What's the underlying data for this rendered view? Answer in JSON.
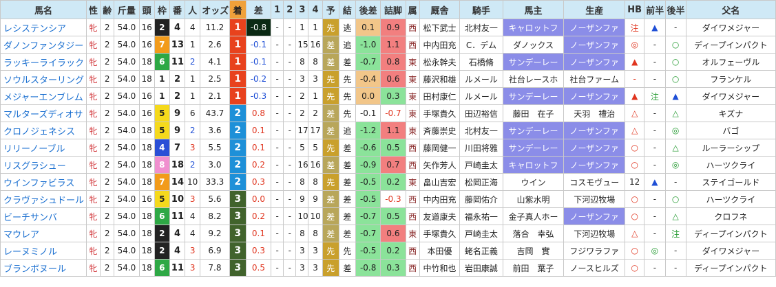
{
  "headers": {
    "name": "馬名",
    "sex": "性",
    "age": "齢",
    "weight": "斤量",
    "heads": "頭",
    "waku": "枠",
    "umaban": "番",
    "ninki": "人",
    "odds": "オッズ",
    "chaku": "着",
    "diff": "差",
    "c1": "1",
    "c2": "2",
    "c3": "3",
    "c4": "4",
    "yoso": "予",
    "kekka": "結",
    "kohansa": "後差",
    "tsumeashi": "詰脚",
    "zoku": "属",
    "kyusha": "厩舎",
    "kishu": "騎手",
    "banushi": "馬主",
    "seisan": "生産",
    "hb": "HB",
    "zenhan": "前半",
    "kohan": "後半",
    "father": "父名"
  },
  "rows": [
    {
      "name": "レシステンシア",
      "sex": "牝",
      "age": "2",
      "weight": "54.0",
      "heads": "16",
      "waku": "2",
      "umaban": "4",
      "ninki": "4",
      "odds": "11.2",
      "chaku": "1",
      "diff": "-0.8",
      "c1": "-",
      "c2": "-",
      "c3": "1",
      "c4": "1",
      "yoso": "先",
      "kekka": "逃",
      "kohansa": "0.1",
      "tsumeashi": "0.9",
      "zoku": "西",
      "kyusha": "松下武士",
      "kishu": "北村友一",
      "banushi": "キャロットフ",
      "seisan": "ノーザンファ",
      "hb": "注",
      "zenhan": "▲",
      "kohan": "-",
      "father": "ダイワメジャー"
    },
    {
      "name": "ダノンファンタジー",
      "sex": "牝",
      "age": "2",
      "weight": "54.0",
      "heads": "16",
      "waku": "7",
      "umaban": "13",
      "ninki": "1",
      "odds": "2.6",
      "chaku": "1",
      "diff": "-0.1",
      "c1": "-",
      "c2": "-",
      "c3": "15",
      "c4": "16",
      "yoso": "差",
      "kekka": "追",
      "kohansa": "-1.0",
      "tsumeashi": "1.1",
      "zoku": "西",
      "kyusha": "中内田充",
      "kishu": "C．デム",
      "banushi": "ダノックス",
      "seisan": "ノーザンファ",
      "hb": "◎",
      "zenhan": "-",
      "kohan": "○",
      "father": "ディープインパクト"
    },
    {
      "name": "ラッキーライラック",
      "sex": "牝",
      "age": "2",
      "weight": "54.0",
      "heads": "18",
      "waku": "6",
      "umaban": "11",
      "ninki": "2",
      "odds": "4.1",
      "chaku": "1",
      "diff": "-0.1",
      "c1": "-",
      "c2": "-",
      "c3": "8",
      "c4": "8",
      "yoso": "差",
      "kekka": "差",
      "kohansa": "-0.7",
      "tsumeashi": "0.8",
      "zoku": "東",
      "kyusha": "松永幹夫",
      "kishu": "石橋脩",
      "banushi": "サンデーレー",
      "seisan": "ノーザンファ",
      "hb": "▲",
      "zenhan": "-",
      "kohan": "○",
      "father": "オルフェーヴル"
    },
    {
      "name": "ソウルスターリング",
      "sex": "牝",
      "age": "2",
      "weight": "54.0",
      "heads": "18",
      "waku": "1",
      "umaban": "2",
      "ninki": "1",
      "odds": "2.5",
      "chaku": "1",
      "diff": "-0.2",
      "c1": "-",
      "c2": "-",
      "c3": "3",
      "c4": "3",
      "yoso": "先",
      "kekka": "先",
      "kohansa": "-0.4",
      "tsumeashi": "0.6",
      "zoku": "東",
      "kyusha": "藤沢和雄",
      "kishu": "ルメール",
      "banushi": "社台レースホ",
      "seisan": "社台ファーム",
      "hb": "-",
      "zenhan": "-",
      "kohan": "○",
      "father": "フランケル"
    },
    {
      "name": "メジャーエンブレム",
      "sex": "牝",
      "age": "2",
      "weight": "54.0",
      "heads": "16",
      "waku": "1",
      "umaban": "2",
      "ninki": "1",
      "odds": "2.1",
      "chaku": "1",
      "diff": "-0.3",
      "c1": "-",
      "c2": "-",
      "c3": "2",
      "c4": "1",
      "yoso": "先",
      "kekka": "先",
      "kohansa": "0.0",
      "tsumeashi": "0.3",
      "zoku": "東",
      "kyusha": "田村康仁",
      "kishu": "ルメール",
      "banushi": "サンデーレー",
      "seisan": "ノーザンファ",
      "hb": "▲",
      "zenhan": "注",
      "kohan": "▲",
      "father": "ダイワメジャー"
    },
    {
      "name": "マルターズディオサ",
      "sex": "牝",
      "age": "2",
      "weight": "54.0",
      "heads": "16",
      "waku": "5",
      "umaban": "9",
      "ninki": "6",
      "odds": "43.7",
      "chaku": "2",
      "diff": "0.8",
      "c1": "-",
      "c2": "-",
      "c3": "2",
      "c4": "2",
      "yoso": "差",
      "kekka": "先",
      "kohansa": "-0.1",
      "tsumeashi": "-0.7",
      "zoku": "東",
      "kyusha": "手塚貴久",
      "kishu": "田辺裕信",
      "banushi": "藤田　在子",
      "seisan": "天羽　禮治",
      "hb": "△",
      "zenhan": "-",
      "kohan": "△",
      "father": "キズナ"
    },
    {
      "name": "クロノジェネシス",
      "sex": "牝",
      "age": "2",
      "weight": "54.0",
      "heads": "18",
      "waku": "5",
      "umaban": "9",
      "ninki": "2",
      "odds": "3.6",
      "chaku": "2",
      "diff": "0.1",
      "c1": "-",
      "c2": "-",
      "c3": "17",
      "c4": "17",
      "yoso": "差",
      "kekka": "追",
      "kohansa": "-1.2",
      "tsumeashi": "1.1",
      "zoku": "東",
      "kyusha": "斉藤崇史",
      "kishu": "北村友一",
      "banushi": "サンデーレー",
      "seisan": "ノーザンファ",
      "hb": "△",
      "zenhan": "-",
      "kohan": "◎",
      "father": "バゴ"
    },
    {
      "name": "リリーノーブル",
      "sex": "牝",
      "age": "2",
      "weight": "54.0",
      "heads": "18",
      "waku": "4",
      "umaban": "7",
      "ninki": "3",
      "odds": "5.5",
      "chaku": "2",
      "diff": "0.1",
      "c1": "-",
      "c2": "-",
      "c3": "5",
      "c4": "5",
      "yoso": "先",
      "kekka": "差",
      "kohansa": "-0.6",
      "tsumeashi": "0.5",
      "zoku": "西",
      "kyusha": "藤岡健一",
      "kishu": "川田将雅",
      "banushi": "サンデーレー",
      "seisan": "ノーザンファ",
      "hb": "○",
      "zenhan": "-",
      "kohan": "△",
      "father": "ルーラーシップ"
    },
    {
      "name": "リスグラシュー",
      "sex": "牝",
      "age": "2",
      "weight": "54.0",
      "heads": "18",
      "waku": "8",
      "umaban": "18",
      "ninki": "2",
      "odds": "3.0",
      "chaku": "2",
      "diff": "0.2",
      "c1": "-",
      "c2": "-",
      "c3": "16",
      "c4": "16",
      "yoso": "差",
      "kekka": "差",
      "kohansa": "-0.9",
      "tsumeashi": "0.7",
      "zoku": "西",
      "kyusha": "矢作芳人",
      "kishu": "戸崎圭太",
      "banushi": "キャロットフ",
      "seisan": "ノーザンファ",
      "hb": "○",
      "zenhan": "-",
      "kohan": "◎",
      "father": "ハーツクライ"
    },
    {
      "name": "ウインファビラス",
      "sex": "牝",
      "age": "2",
      "weight": "54.0",
      "heads": "18",
      "waku": "7",
      "umaban": "14",
      "ninki": "10",
      "odds": "33.3",
      "chaku": "2",
      "diff": "0.3",
      "c1": "-",
      "c2": "-",
      "c3": "8",
      "c4": "8",
      "yoso": "先",
      "kekka": "差",
      "kohansa": "-0.5",
      "tsumeashi": "0.2",
      "zoku": "東",
      "kyusha": "畠山吉宏",
      "kishu": "松岡正海",
      "banushi": "ウイン",
      "seisan": "コスモヴュー",
      "hb": "12",
      "zenhan": "▲",
      "kohan": "-",
      "father": "ステイゴールド"
    },
    {
      "name": "クラヴァシュドール",
      "sex": "牝",
      "age": "2",
      "weight": "54.0",
      "heads": "16",
      "waku": "5",
      "umaban": "10",
      "ninki": "3",
      "odds": "5.6",
      "chaku": "3",
      "diff": "0.0",
      "c1": "-",
      "c2": "-",
      "c3": "9",
      "c4": "9",
      "yoso": "差",
      "kekka": "差",
      "kohansa": "-0.5",
      "tsumeashi": "-0.3",
      "zoku": "西",
      "kyusha": "中内田充",
      "kishu": "藤岡佑介",
      "banushi": "山紫水明",
      "seisan": "下河辺牧場",
      "hb": "○",
      "zenhan": "-",
      "kohan": "○",
      "father": "ハーツクライ"
    },
    {
      "name": "ビーチサンバ",
      "sex": "牝",
      "age": "2",
      "weight": "54.0",
      "heads": "18",
      "waku": "6",
      "umaban": "11",
      "ninki": "4",
      "odds": "8.2",
      "chaku": "3",
      "diff": "0.2",
      "c1": "-",
      "c2": "-",
      "c3": "10",
      "c4": "10",
      "yoso": "差",
      "kekka": "差",
      "kohansa": "-0.7",
      "tsumeashi": "0.5",
      "zoku": "西",
      "kyusha": "友道康夫",
      "kishu": "福永祐一",
      "banushi": "金子真人ホー",
      "seisan": "ノーザンファ",
      "hb": "○",
      "zenhan": "-",
      "kohan": "△",
      "father": "クロフネ"
    },
    {
      "name": "マウレア",
      "sex": "牝",
      "age": "2",
      "weight": "54.0",
      "heads": "18",
      "waku": "2",
      "umaban": "4",
      "ninki": "4",
      "odds": "9.2",
      "chaku": "3",
      "diff": "0.1",
      "c1": "-",
      "c2": "-",
      "c3": "8",
      "c4": "8",
      "yoso": "差",
      "kekka": "差",
      "kohansa": "-0.7",
      "tsumeashi": "0.6",
      "zoku": "東",
      "kyusha": "手塚貴久",
      "kishu": "戸崎圭太",
      "banushi": "落合　幸弘",
      "seisan": "下河辺牧場",
      "hb": "△",
      "zenhan": "-",
      "kohan": "注",
      "father": "ディープインパクト"
    },
    {
      "name": "レーヌミノル",
      "sex": "牝",
      "age": "2",
      "weight": "54.0",
      "heads": "18",
      "waku": "2",
      "umaban": "4",
      "ninki": "3",
      "odds": "6.9",
      "chaku": "3",
      "diff": "0.3",
      "c1": "-",
      "c2": "-",
      "c3": "3",
      "c4": "3",
      "yoso": "先",
      "kekka": "先",
      "kohansa": "-0.5",
      "tsumeashi": "0.2",
      "zoku": "西",
      "kyusha": "本田優",
      "kishu": "蛯名正義",
      "banushi": "吉岡　實",
      "seisan": "フジワラファ",
      "hb": "○",
      "zenhan": "◎",
      "kohan": "-",
      "father": "ダイワメジャー"
    },
    {
      "name": "ブランボヌール",
      "sex": "牝",
      "age": "2",
      "weight": "54.0",
      "heads": "18",
      "waku": "6",
      "umaban": "11",
      "ninki": "3",
      "odds": "7.8",
      "chaku": "3",
      "diff": "0.5",
      "c1": "-",
      "c2": "-",
      "c3": "3",
      "c4": "3",
      "yoso": "先",
      "kekka": "差",
      "kohansa": "-0.8",
      "tsumeashi": "0.3",
      "zoku": "西",
      "kyusha": "中竹和也",
      "kishu": "岩田康誠",
      "banushi": "前田　葉子",
      "seisan": "ノースヒルズ",
      "hb": "○",
      "zenhan": "-",
      "kohan": "-",
      "father": "ディープインパクト"
    }
  ]
}
